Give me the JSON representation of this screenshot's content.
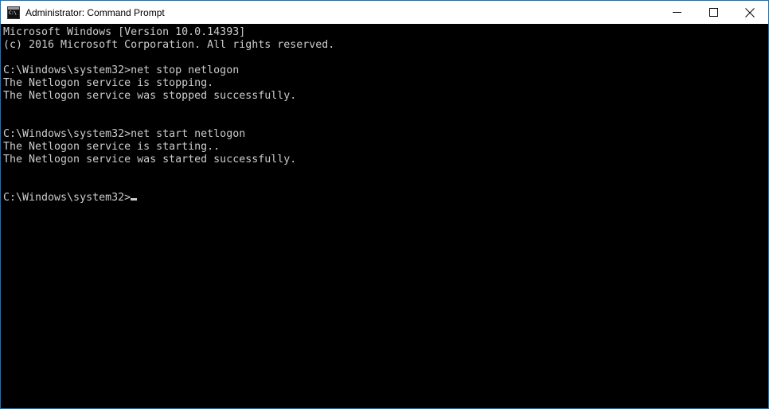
{
  "window": {
    "title": "Administrator: Command Prompt",
    "icon_name": "command-prompt-icon",
    "icon_glyph": "C:\\",
    "border_color": "#0078d7",
    "titlebar_background": "#ffffff",
    "titlebar_text_color": "#000000"
  },
  "window_controls": {
    "minimize_label": "Minimize",
    "maximize_label": "Maximize",
    "close_label": "Close"
  },
  "console": {
    "background": "#000000",
    "foreground": "#cccccc",
    "prompt": "C:\\Windows\\system32>",
    "lines": [
      "Microsoft Windows [Version 10.0.14393]",
      "(c) 2016 Microsoft Corporation. All rights reserved.",
      "",
      "C:\\Windows\\system32>net stop netlogon",
      "The Netlogon service is stopping.",
      "The Netlogon service was stopped successfully.",
      "",
      "",
      "C:\\Windows\\system32>net start netlogon",
      "The Netlogon service is starting..",
      "The Netlogon service was started successfully.",
      "",
      ""
    ],
    "last_prompt_line": "C:\\Windows\\system32>",
    "cursor_visible": true
  }
}
